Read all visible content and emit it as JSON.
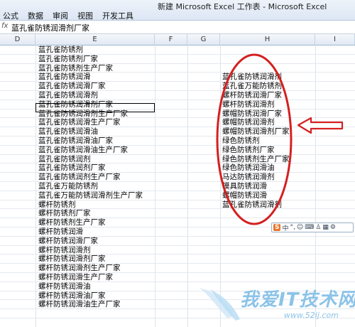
{
  "window": {
    "title": "新建 Microsoft Excel 工作表 - Microsoft Excel"
  },
  "ribbon": {
    "tabs": [
      "公式",
      "数据",
      "审阅",
      "视图",
      "开发工具"
    ]
  },
  "formula_bar": {
    "fx_label": "fx",
    "content": "蓝孔雀防锈润滑剂厂家"
  },
  "columns": [
    "D",
    "E",
    "F",
    "G",
    "H",
    "I"
  ],
  "column_e": [
    "蓝孔雀防锈剂",
    "蓝孔雀防锈剂厂家",
    "蓝孔雀防锈剂生产厂家",
    "蓝孔雀防锈润滑",
    "蓝孔雀防锈润滑厂家",
    "蓝孔雀防锈润滑剂",
    "蓝孔雀防锈润滑剂厂家",
    "蓝孔雀防锈润滑剂生产厂家",
    "蓝孔雀防锈润滑生产厂家",
    "蓝孔雀防锈润滑油",
    "蓝孔雀防锈润滑油厂家",
    "蓝孔雀防锈润滑油生产厂家",
    "蓝孔雀防锈润剂",
    "蓝孔雀防锈润剂厂家",
    "蓝孔雀防锈润剂生产厂家",
    "蓝孔雀万能防锈剂",
    "蓝孔雀万能防锈润滑剂生产厂家",
    "螺杆防锈剂",
    "螺杆防锈剂厂家",
    "螺杆防锈剂生产厂家",
    "螺杆防锈润滑",
    "螺杆防锈润滑厂家",
    "螺杆防锈润滑剂",
    "螺杆防锈润滑剂厂家",
    "螺杆防锈润滑剂生产厂家",
    "螺杆防锈润滑生产厂家",
    "螺杆防锈润滑油",
    "螺杆防锈润滑油厂家",
    "螺杆防锈润滑油生产厂家"
  ],
  "column_h": [
    "蓝孔雀防锈润滑剂",
    "蓝孔雀万能防锈剂",
    "螺杆防锈润滑厂家",
    "螺杆防锈润滑剂",
    "螺帽防锈润滑厂家",
    "螺帽防锈润滑剂",
    "螺帽防锈润滑剂厂家",
    "绿色防锈剂",
    "绿色防锈剂厂家",
    "绿色防锈剂生产厂家",
    "绿色防锈润滑油",
    "马达防锈润滑剂",
    "模具防锈润滑",
    "螺帽防锈润滑",
    "蓝孔雀防锈润滑剂"
  ],
  "ime_bar": {
    "logo": "S",
    "lang": "中",
    "items": [
      "°,",
      "☺",
      "⌨",
      "♙",
      "▦",
      "⚙"
    ]
  },
  "watermark": {
    "text": "我爱IT技术网",
    "url": "www.52ij.com"
  },
  "colors": {
    "annotation": "#d42020",
    "header_bg": "#e2e9f3",
    "watermark": "#8cc3e8"
  }
}
